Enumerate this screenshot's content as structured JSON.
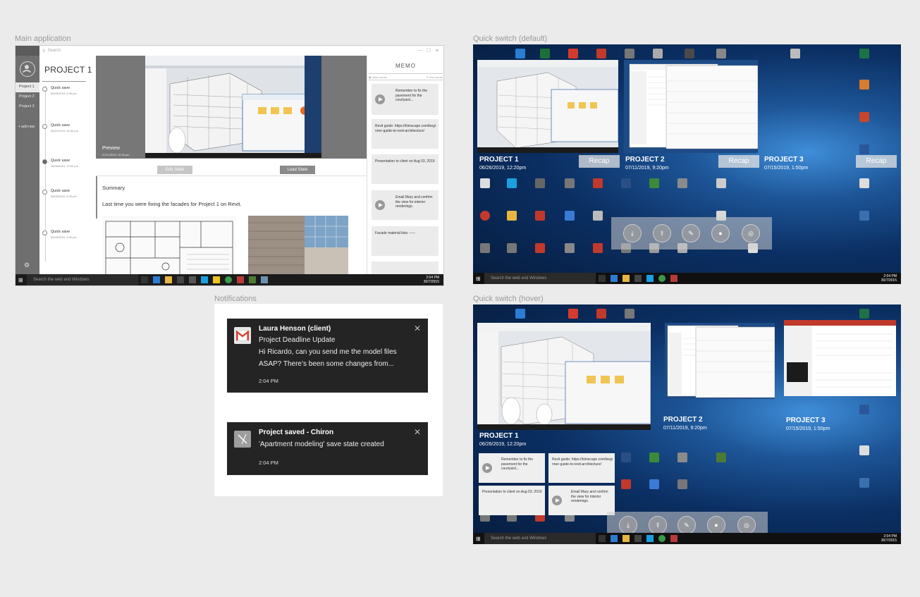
{
  "labels": {
    "main": "Main application",
    "notifications": "Notifications",
    "qs_default": "Quick switch (default)",
    "qs_hover": "Quick switch (hover)"
  },
  "app": {
    "search_placeholder": "Search",
    "nav": {
      "items": [
        "Project 1",
        "Project 2",
        "Project 3"
      ],
      "add": "+ add new"
    },
    "project_title": "PROJECT 1",
    "saves": [
      {
        "name": "Quick save",
        "date": "06/25/2019, 4:25 pm"
      },
      {
        "name": "Quick save",
        "date": "06/21/2019, 10:30 pm"
      },
      {
        "name": "Quick save",
        "date": "06/08/2019, 12:00 pm"
      },
      {
        "name": "Quick save",
        "date": "06/05/2019, 5:29 pm"
      },
      {
        "name": "Quick save",
        "date": "05/25/2019, 4:00 pm"
      }
    ],
    "preview_label": "Preview",
    "preview_date": "07/11/2019, 10:26 pm",
    "edit_state": "Edit State",
    "load_state": "Load State",
    "summary_title": "Summary",
    "summary_text": "Last time you were fixing the facades for Project 1 on Revit.",
    "memo": {
      "title": "MEMO",
      "toolbar_left": "voice memo",
      "toolbar_right": "text memo",
      "cards": [
        {
          "text": "Remember to fix the pavement for the courtyard...",
          "audio": true
        },
        {
          "text": "Revit guide: https://bimscape.com/beginner-guide-to-revit-architecture/",
          "audio": false
        },
        {
          "text": "Presentation to client on Aug 03, 2019",
          "audio": false
        },
        {
          "text": "Email Mary and confirm the view for interior renderings.",
          "audio": true
        },
        {
          "text": "Facade material lists: -----",
          "audio": false
        }
      ]
    },
    "taskbar": {
      "search": "Search the web and Windows",
      "time": "2:04 PM",
      "date": "30/7/2015"
    }
  },
  "notifications": [
    {
      "title": "Laura Henson (client)",
      "line1": "Project Deadline Update",
      "line2": "Hi Ricardo, can you send me the model files",
      "line3": "ASAP? There’s been some changes from...",
      "time": "2:04 PM",
      "icon": "gmail-icon"
    },
    {
      "title": "Project saved - Chiron",
      "line1": "'Apartment modeling' save state created",
      "time": "2:04 PM",
      "icon": "chiron-icon"
    }
  ],
  "quick_switch": {
    "projects": [
      {
        "name": "PROJECT 1",
        "date": "06/26/2019, 12:20pm"
      },
      {
        "name": "PROJECT 2",
        "date": "07/11/2019, 9:20pm"
      },
      {
        "name": "PROJECT 3",
        "date": "07/15/2019, 1:50pm"
      }
    ],
    "recap": "Recap",
    "taskbar_search": "Search the web and Windows",
    "time": "2:04 PM",
    "date": "30/7/2015",
    "hover_memos": [
      {
        "text": "Remember to fix the pavement for the courtyard...",
        "audio": true
      },
      {
        "text": "Revit guide: https://bimscape.com/beginner-guide-to-revit-architecture/",
        "audio": false
      },
      {
        "text": "Presentation to client on Aug 03, 2019",
        "audio": false
      },
      {
        "text": "Email Mary and confirm the view for interior renderings.",
        "audio": true
      }
    ]
  },
  "colors": {
    "toast_bg": "#242424",
    "nav_rail": "#6f6f6f",
    "taskbar": "#1b1b1b"
  }
}
